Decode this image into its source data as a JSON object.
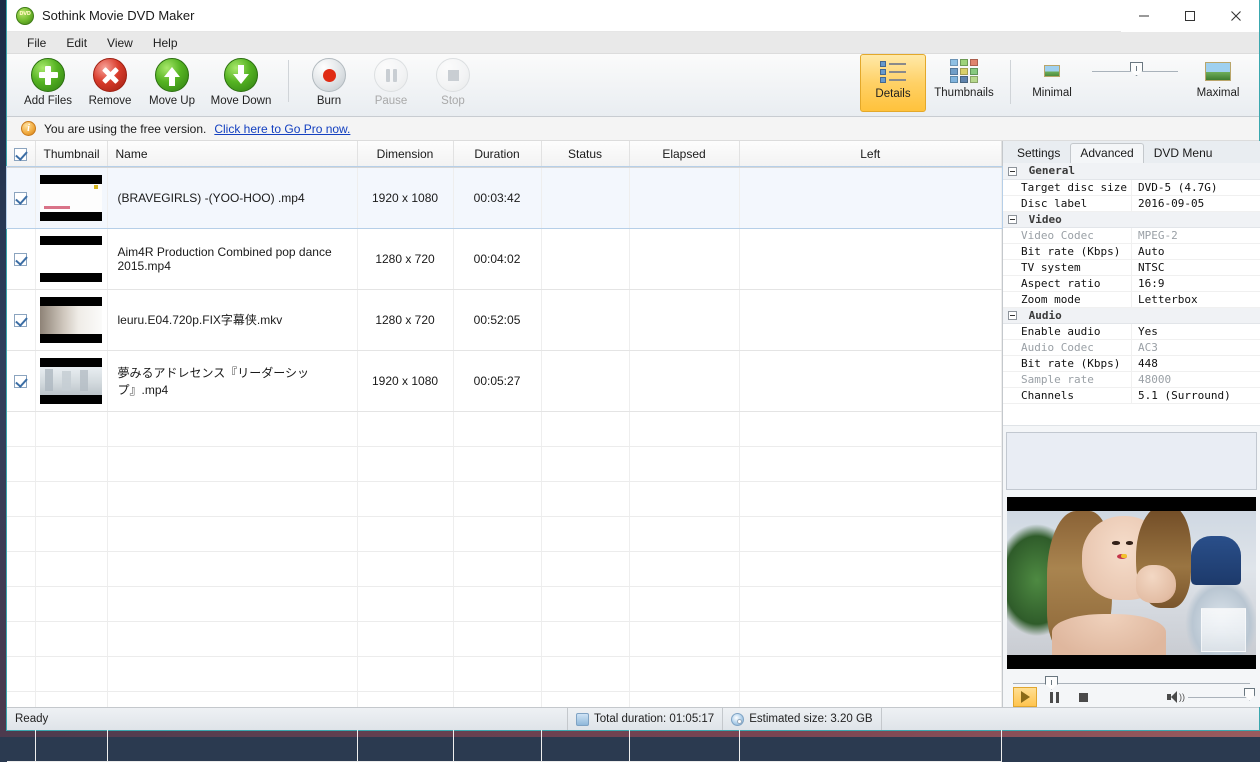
{
  "window": {
    "title": "Sothink Movie DVD Maker",
    "app_icon": "dvd-disc-icon",
    "minimize": "minimize-icon",
    "maximize": "maximize-icon",
    "close": "close-icon"
  },
  "menubar": {
    "items": [
      "File",
      "Edit",
      "View",
      "Help"
    ]
  },
  "toolbar": {
    "items": [
      {
        "label": "Add Files",
        "icon": "plus-circle-icon",
        "state": "enabled"
      },
      {
        "label": "Remove",
        "icon": "x-circle-icon",
        "state": "enabled"
      },
      {
        "label": "Move Up",
        "icon": "arrow-up-circle-icon",
        "state": "enabled"
      },
      {
        "label": "Move Down",
        "icon": "arrow-down-circle-icon",
        "state": "enabled"
      },
      {
        "label": "Burn",
        "icon": "record-circle-icon",
        "state": "enabled"
      },
      {
        "label": "Pause",
        "icon": "pause-circle-icon",
        "state": "disabled"
      },
      {
        "label": "Stop",
        "icon": "stop-circle-icon",
        "state": "disabled"
      }
    ],
    "view_modes": [
      {
        "label": "Details",
        "icon": "list-details-icon",
        "active": true
      },
      {
        "label": "Thumbnails",
        "icon": "grid-thumbnails-icon",
        "active": false
      }
    ],
    "size_slider": {
      "min_label": "Minimal",
      "max_label": "Maximal",
      "min_icon": "small-image-icon",
      "max_icon": "large-image-icon",
      "value_percent": 45
    }
  },
  "notice": {
    "icon": "info-icon",
    "text": "You are using the free version.",
    "link": "Click here to Go Pro now."
  },
  "filelist": {
    "select_all_checked": true,
    "columns": [
      "Thumbnail",
      "Name",
      "Dimension",
      "Duration",
      "Status",
      "Elapsed",
      "Left"
    ],
    "rows": [
      {
        "checked": true,
        "name": "(BRAVEGIRLS) -(YOO-HOO) .mp4",
        "dimension": "1920 x 1080",
        "duration": "00:03:42",
        "status": "",
        "elapsed": "",
        "left": "",
        "selected": true
      },
      {
        "checked": true,
        "name": "Aim4R Production Combined pop dance 2015.mp4",
        "dimension": "1280 x 720",
        "duration": "00:04:02",
        "status": "",
        "elapsed": "",
        "left": "",
        "selected": false
      },
      {
        "checked": true,
        "name": "leuru.E04.720p.FIX字幕侠.mkv",
        "dimension": "1280 x 720",
        "duration": "00:52:05",
        "status": "",
        "elapsed": "",
        "left": "",
        "selected": false
      },
      {
        "checked": true,
        "name": "夢みるアドレセンス『リーダーシップ』.mp4",
        "dimension": "1920 x 1080",
        "duration": "00:05:27",
        "status": "",
        "elapsed": "",
        "left": "",
        "selected": false
      }
    ]
  },
  "rightpanel": {
    "tabs": [
      {
        "label": "Settings",
        "active": false
      },
      {
        "label": "Advanced",
        "active": true
      },
      {
        "label": "DVD Menu",
        "active": false
      }
    ],
    "groups": [
      {
        "name": "General",
        "rows": [
          {
            "key": "Target disc size",
            "value": "DVD-5 (4.7G)",
            "dimmed": false
          },
          {
            "key": "Disc label",
            "value": "2016-09-05",
            "dimmed": false
          }
        ]
      },
      {
        "name": "Video",
        "rows": [
          {
            "key": "Video Codec",
            "value": "MPEG-2",
            "dimmed": true
          },
          {
            "key": "Bit rate (Kbps)",
            "value": "Auto",
            "dimmed": false
          },
          {
            "key": "TV system",
            "value": "NTSC",
            "dimmed": false
          },
          {
            "key": "Aspect ratio",
            "value": "16:9",
            "dimmed": false
          },
          {
            "key": "Zoom mode",
            "value": "Letterbox",
            "dimmed": false
          }
        ]
      },
      {
        "name": "Audio",
        "rows": [
          {
            "key": "Enable audio",
            "value": "Yes",
            "dimmed": false
          },
          {
            "key": "Audio Codec",
            "value": "AC3",
            "dimmed": true
          },
          {
            "key": "Bit rate (Kbps)",
            "value": "448",
            "dimmed": false
          },
          {
            "key": "Sample rate",
            "value": "48000",
            "dimmed": true
          },
          {
            "key": "Channels",
            "value": "5.1 (Surround)",
            "dimmed": false
          }
        ]
      }
    ],
    "description": "",
    "player": {
      "seek_percent": 14,
      "play_icon": "play-icon",
      "pause_icon": "pause-icon",
      "stop_icon": "stop-icon",
      "volume_icon": "speaker-icon",
      "volume_percent": 100
    }
  },
  "statusbar": {
    "ready": "Ready",
    "total_duration": "Total duration: 01:05:17",
    "total_duration_icon": "clock-icon",
    "estimated_size": "Estimated size: 3.20 GB",
    "estimated_size_icon": "disc-icon"
  },
  "colors": {
    "accent": "#ffc23c",
    "link": "#1440c0",
    "window_border": "#3aa7ae"
  }
}
